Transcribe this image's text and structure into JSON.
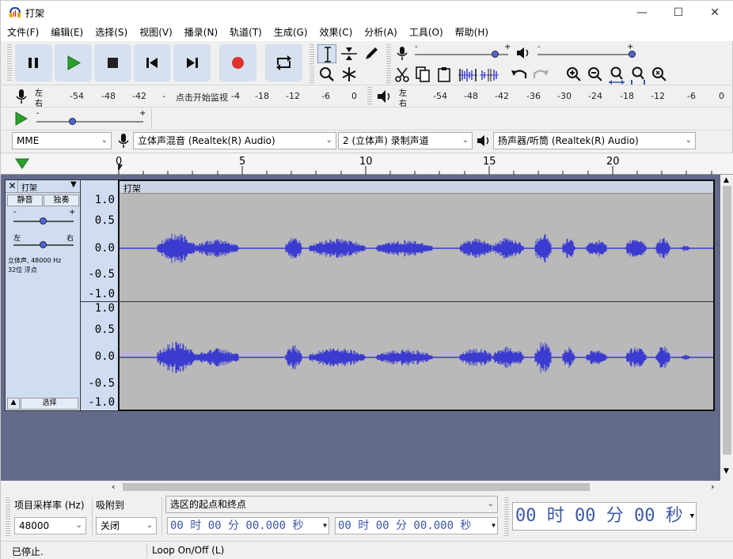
{
  "window": {
    "title": "打架"
  },
  "menu": [
    "文件(F)",
    "编辑(E)",
    "选择(S)",
    "视图(V)",
    "播录(N)",
    "轨道(T)",
    "生成(G)",
    "效果(C)",
    "分析(A)",
    "工具(O)",
    "帮助(H)"
  ],
  "meters": {
    "record_lr": [
      "左",
      "右"
    ],
    "record_scale": [
      "-54",
      "-48",
      "-42",
      "-"
    ],
    "record_hint": "点击开始监视",
    "record_scale2": [
      "-4",
      "-18",
      "-12",
      "-6",
      "0"
    ],
    "play_lr": [
      "左",
      "右"
    ],
    "play_scale": [
      "-54",
      "-48",
      "-42",
      "-36",
      "-30",
      "-24",
      "-18",
      "-12",
      "-6",
      "0"
    ]
  },
  "sliders": {
    "minus": "-",
    "plus": "+"
  },
  "devices": {
    "host": "MME",
    "record_device": "立体声混音 (Realtek(R) Audio)",
    "channels": "2 (立体声) 录制声道",
    "playback_device": "扬声器/听筒 (Realtek(R) Audio)"
  },
  "timeline": {
    "ticks": [
      "0",
      "5",
      "10",
      "15",
      "20"
    ]
  },
  "track": {
    "name": "打架",
    "mute": "静音",
    "solo": "独奏",
    "gain_minus": "-",
    "gain_plus": "+",
    "pan_left": "左",
    "pan_right": "右",
    "info_line1": "立体声, 48000 Hz",
    "info_line2": "32位 浮点",
    "select": "选择",
    "clip_name": "打架",
    "scale_upper": [
      "1.0",
      "0.5",
      "0.0",
      "-0.5",
      "-1.0"
    ],
    "scale_lower": [
      "1.0",
      "0.5",
      "0.0",
      "-0.5",
      "-1.0"
    ]
  },
  "bottom": {
    "rate_label": "项目采样率 (Hz)",
    "rate_value": "48000",
    "snap_label": "吸附到",
    "snap_value": "关闭",
    "selection_mode": "选区的起点和终点",
    "sel_start": "00 时 00 分 00.000 秒",
    "sel_end": "00 时 00 分 00.000 秒",
    "position": "00 时 00 分 00 秒"
  },
  "status": {
    "state": "已停止.",
    "hint": "Loop On/Off (L)"
  },
  "colors": {
    "waveform": "#3b3bd0",
    "track_bg": "#646a8a",
    "panel": "#cfdcf2",
    "record": "#e03030",
    "play": "#2aa02a"
  }
}
